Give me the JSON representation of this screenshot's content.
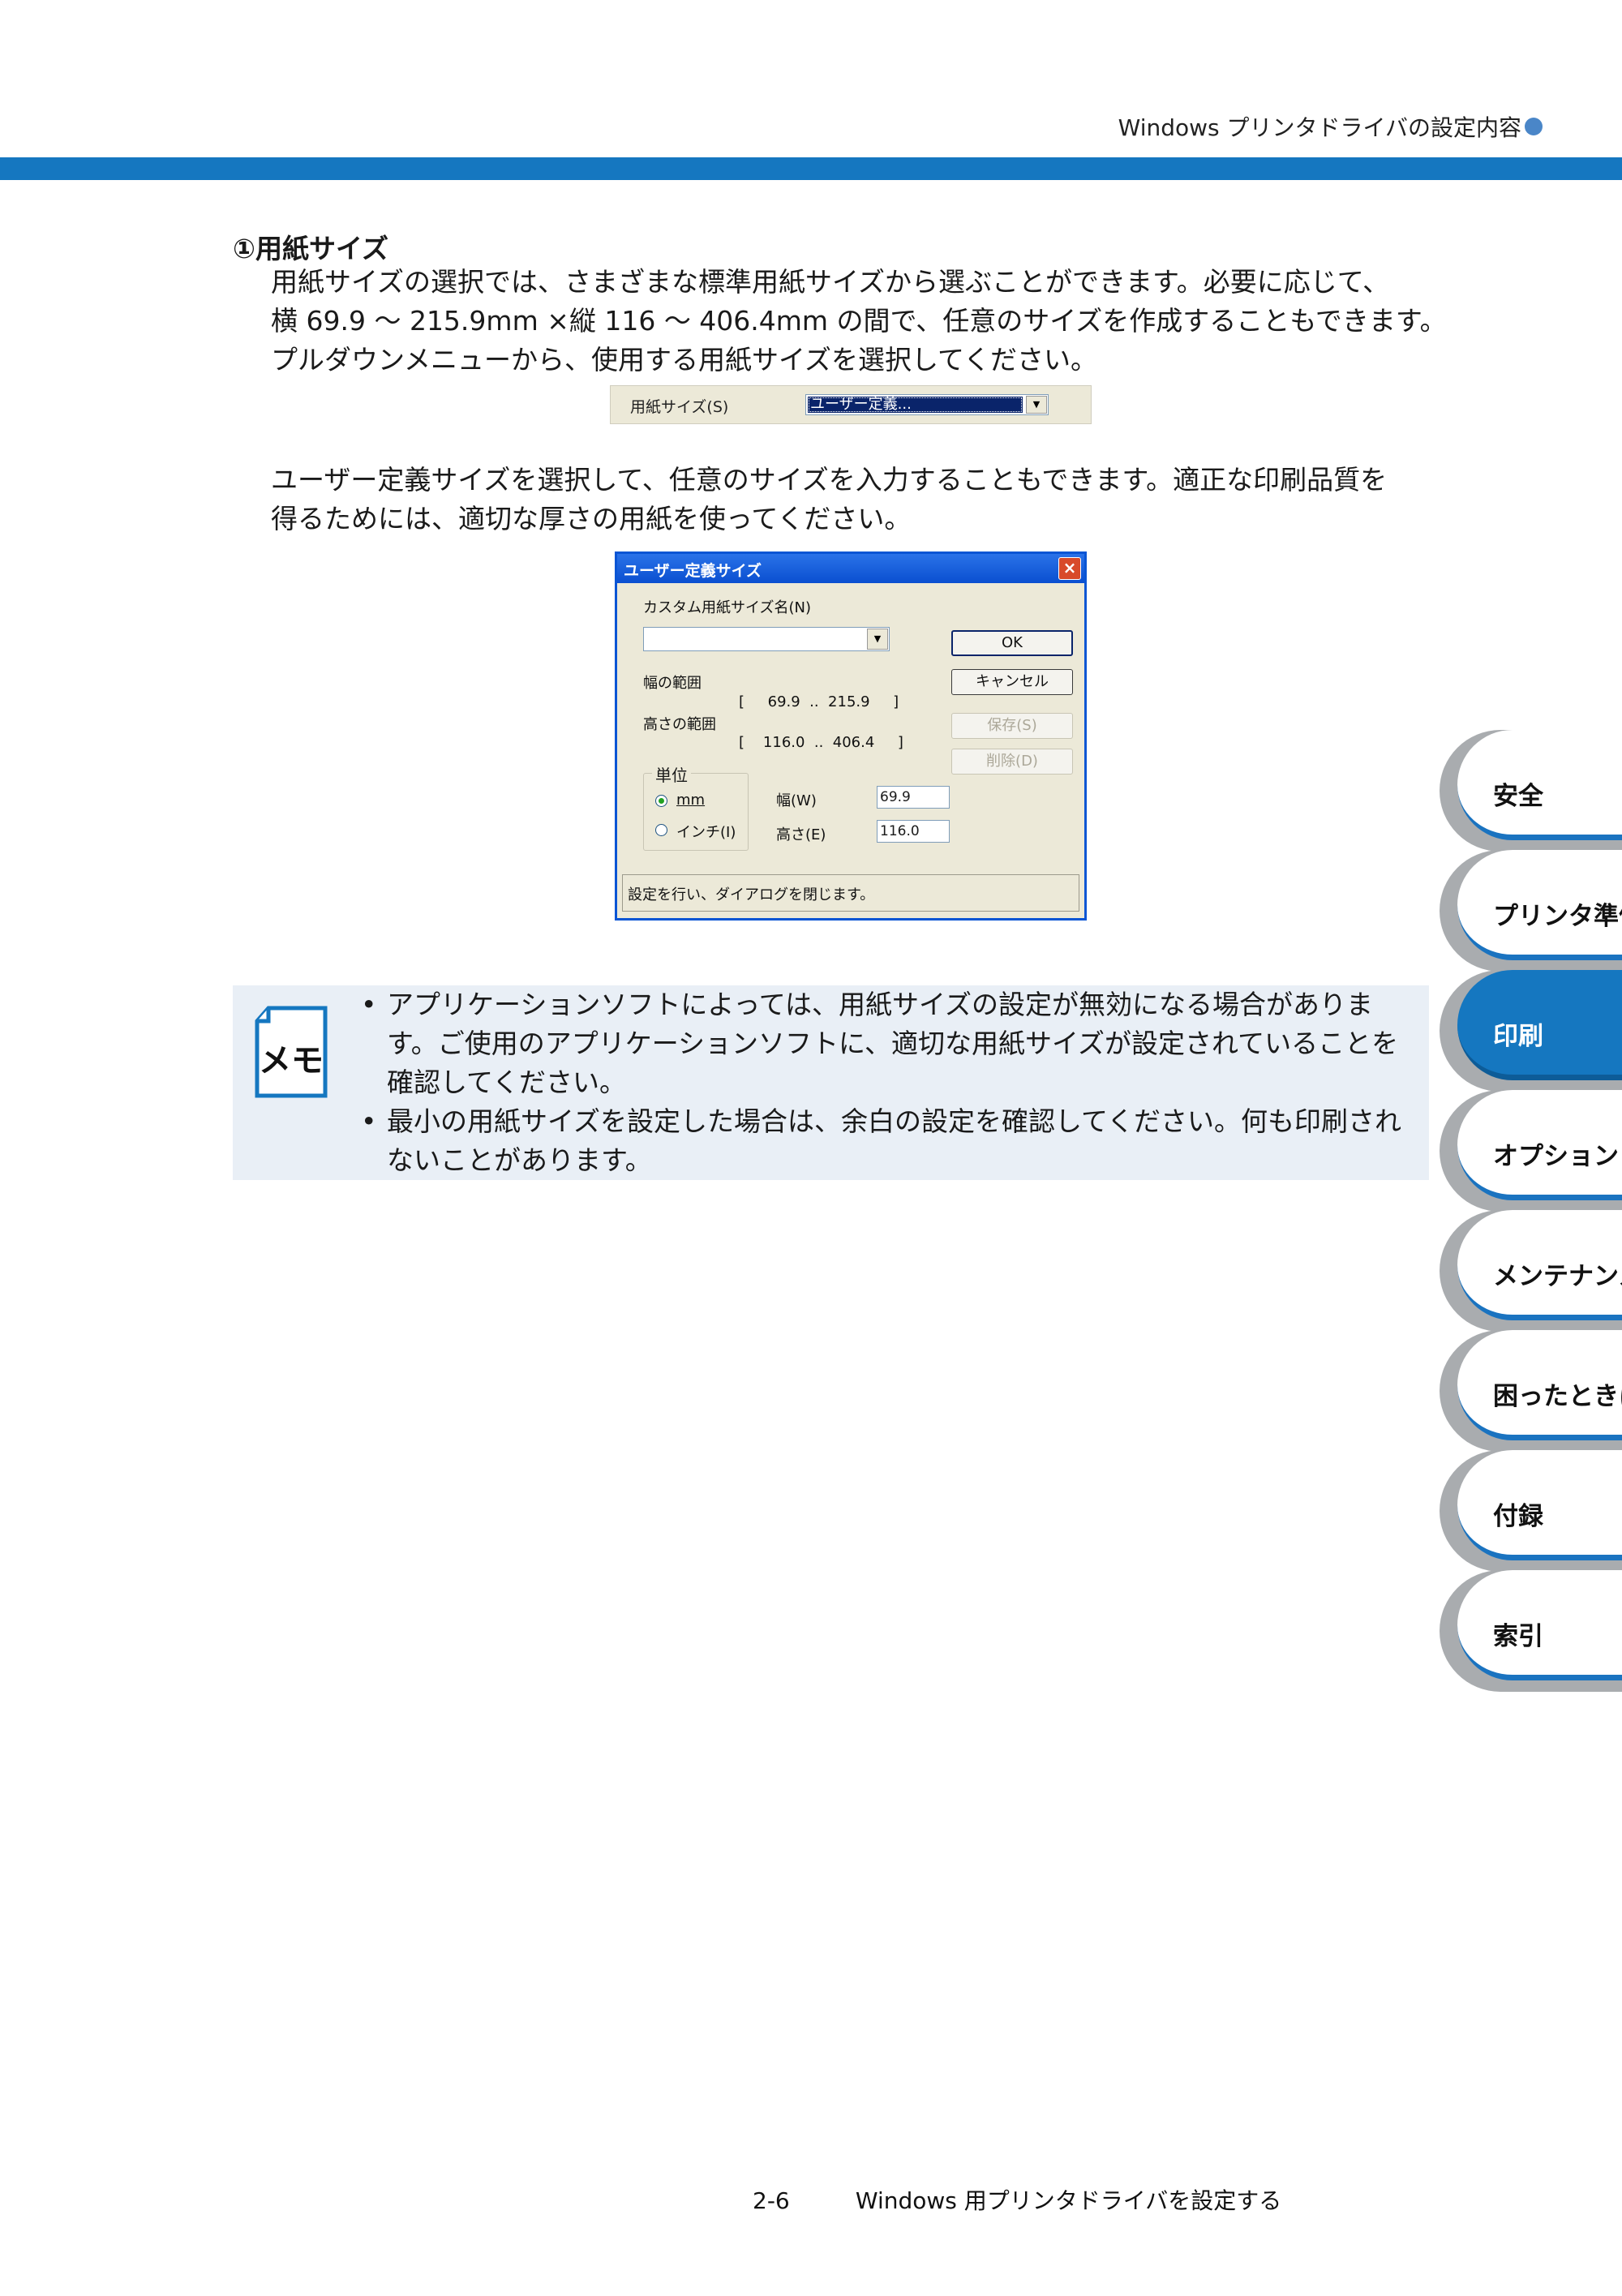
{
  "header": {
    "title": "Windows プリンタドライバの設定内容"
  },
  "section": {
    "heading": "①用紙サイズ",
    "para1": [
      "用紙サイズの選択では、さまざまな標準用紙サイズから選ぶことができます。必要に応じて、",
      "横 69.9 〜 215.9mm ×縦 116 〜 406.4mm の間で、任意のサイズを作成することもできます。",
      "プルダウンメニューから、使用する用紙サイズを選択してください。"
    ],
    "para2": [
      "ユーザー定義サイズを選択して、任意のサイズを入力することもできます。適正な印刷品質を",
      "得るためには、適切な厚さの用紙を使ってください。"
    ]
  },
  "paper_size_row": {
    "label": "用紙サイズ(S)",
    "selected": "ユーザー定義..."
  },
  "dialog": {
    "title": "ユーザー定義サイズ",
    "close": "×",
    "custom_name_label": "カスタム用紙サイズ名(N)",
    "width_range_label": "幅の範囲",
    "width_range": "[     69.9  ..  215.9     ]",
    "height_range_label": "高さの範囲",
    "height_range": "[    116.0  ..  406.4     ]",
    "unit_group": "単位",
    "unit_mm": "mm",
    "unit_inch": "インチ(I)",
    "width_label": "幅(W)",
    "width_value": "69.9",
    "height_label": "高さ(E)",
    "height_value": "116.0",
    "buttons": {
      "ok": "OK",
      "cancel": "キャンセル",
      "save": "保存(S)",
      "delete": "削除(D)"
    },
    "status": "設定を行い、ダイアログを閉じます。"
  },
  "memo": {
    "icon_text": "メモ",
    "items": [
      [
        "アプリケーションソフトによっては、用紙サイズの設定が無効になる場合がありま",
        "す。ご使用のアプリケーションソフトに、適切な用紙サイズが設定されていることを",
        "確認してください。"
      ],
      [
        "最小の用紙サイズを設定した場合は、余白の設定を確認してください。何も印刷され",
        "ないことがあります。"
      ]
    ]
  },
  "tabs": [
    "安全",
    "プリンタ準備",
    "印刷",
    "オプション",
    "メンテナンス",
    "困ったときは",
    "付録",
    "索引"
  ],
  "footer": {
    "page": "2-6",
    "title": "Windows 用プリンタドライバを設定する"
  },
  "colors": {
    "accent": "#1577c0",
    "memo_bg": "#e9eff6",
    "tab_gray": "#a9acaf"
  }
}
